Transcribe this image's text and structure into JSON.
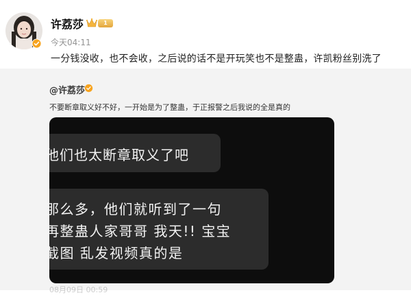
{
  "post": {
    "username": "许荔莎",
    "level": "1",
    "time": "今天04:11",
    "text": "一分钱没收，也不会收，之后说的话不是开玩笑也不是整蛊，许凯粉丝别洗了"
  },
  "quote": {
    "author": "@许荔莎",
    "text": "不要断章取义好不好，一开始是为了整蛊，于正报警之后我说的全是真的"
  },
  "chat_image": {
    "bubble_1": "他们也太断章取义了吧",
    "bubble_2_lines": [
      "那么多，他们就听到了一句",
      "再整蛊人家哥哥 我天!! 宝宝",
      "截图 乱发视频真的是"
    ],
    "timestamp": "08月09日 00:59"
  },
  "icons": {
    "avatar": "avatar-portrait",
    "verify": "verified-badge-icon",
    "crown": "crown-icon"
  },
  "colors": {
    "verify_orange": "#f7a420",
    "level_gold": "#e3a63e",
    "chat_bg": "#0d0d0d",
    "bubble_bg": "#2c2c2c"
  }
}
